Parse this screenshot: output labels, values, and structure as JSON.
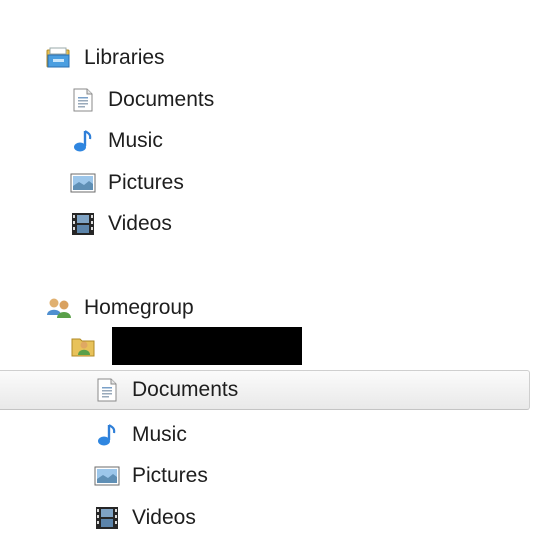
{
  "nav": {
    "libraries": {
      "label": "Libraries",
      "items": [
        {
          "label": "Documents",
          "icon": "document-icon"
        },
        {
          "label": "Music",
          "icon": "music-note-icon"
        },
        {
          "label": "Pictures",
          "icon": "picture-icon"
        },
        {
          "label": "Videos",
          "icon": "film-icon"
        }
      ]
    },
    "homegroup": {
      "label": "Homegroup",
      "user": {
        "label": "",
        "redacted": true,
        "items": [
          {
            "label": "Documents",
            "icon": "document-icon",
            "selected": true
          },
          {
            "label": "Music",
            "icon": "music-note-icon"
          },
          {
            "label": "Pictures",
            "icon": "picture-icon"
          },
          {
            "label": "Videos",
            "icon": "film-icon"
          }
        ]
      }
    }
  },
  "colors": {
    "selection_top": "#fbfbfb",
    "selection_bottom": "#e9e9e9",
    "selection_border": "#c4c4c4",
    "text": "#1e1e1e"
  }
}
